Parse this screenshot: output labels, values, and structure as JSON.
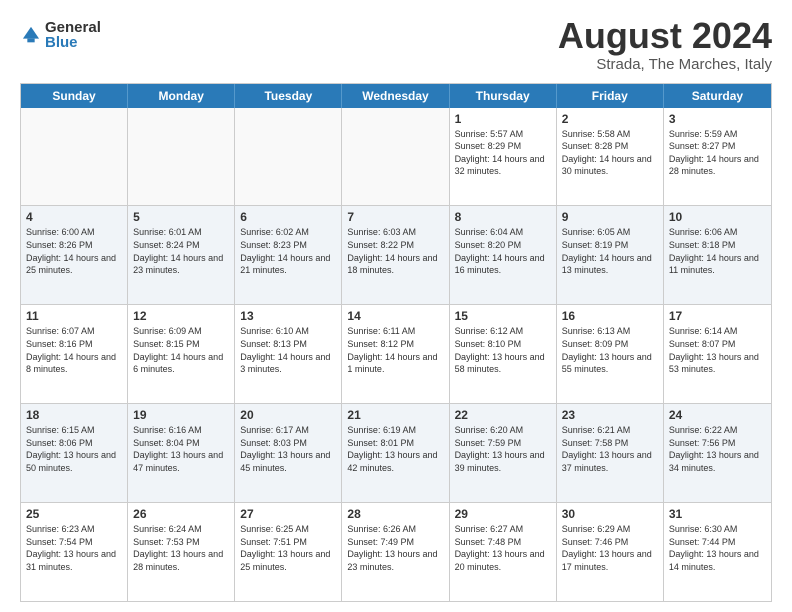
{
  "logo": {
    "general": "General",
    "blue": "Blue"
  },
  "title": "August 2024",
  "subtitle": "Strada, The Marches, Italy",
  "header_days": [
    "Sunday",
    "Monday",
    "Tuesday",
    "Wednesday",
    "Thursday",
    "Friday",
    "Saturday"
  ],
  "rows": [
    [
      {
        "day": "",
        "empty": true
      },
      {
        "day": "",
        "empty": true
      },
      {
        "day": "",
        "empty": true
      },
      {
        "day": "",
        "empty": true
      },
      {
        "day": "1",
        "sunrise": "Sunrise: 5:57 AM",
        "sunset": "Sunset: 8:29 PM",
        "daylight": "Daylight: 14 hours and 32 minutes."
      },
      {
        "day": "2",
        "sunrise": "Sunrise: 5:58 AM",
        "sunset": "Sunset: 8:28 PM",
        "daylight": "Daylight: 14 hours and 30 minutes."
      },
      {
        "day": "3",
        "sunrise": "Sunrise: 5:59 AM",
        "sunset": "Sunset: 8:27 PM",
        "daylight": "Daylight: 14 hours and 28 minutes."
      }
    ],
    [
      {
        "day": "4",
        "sunrise": "Sunrise: 6:00 AM",
        "sunset": "Sunset: 8:26 PM",
        "daylight": "Daylight: 14 hours and 25 minutes."
      },
      {
        "day": "5",
        "sunrise": "Sunrise: 6:01 AM",
        "sunset": "Sunset: 8:24 PM",
        "daylight": "Daylight: 14 hours and 23 minutes."
      },
      {
        "day": "6",
        "sunrise": "Sunrise: 6:02 AM",
        "sunset": "Sunset: 8:23 PM",
        "daylight": "Daylight: 14 hours and 21 minutes."
      },
      {
        "day": "7",
        "sunrise": "Sunrise: 6:03 AM",
        "sunset": "Sunset: 8:22 PM",
        "daylight": "Daylight: 14 hours and 18 minutes."
      },
      {
        "day": "8",
        "sunrise": "Sunrise: 6:04 AM",
        "sunset": "Sunset: 8:20 PM",
        "daylight": "Daylight: 14 hours and 16 minutes."
      },
      {
        "day": "9",
        "sunrise": "Sunrise: 6:05 AM",
        "sunset": "Sunset: 8:19 PM",
        "daylight": "Daylight: 14 hours and 13 minutes."
      },
      {
        "day": "10",
        "sunrise": "Sunrise: 6:06 AM",
        "sunset": "Sunset: 8:18 PM",
        "daylight": "Daylight: 14 hours and 11 minutes."
      }
    ],
    [
      {
        "day": "11",
        "sunrise": "Sunrise: 6:07 AM",
        "sunset": "Sunset: 8:16 PM",
        "daylight": "Daylight: 14 hours and 8 minutes."
      },
      {
        "day": "12",
        "sunrise": "Sunrise: 6:09 AM",
        "sunset": "Sunset: 8:15 PM",
        "daylight": "Daylight: 14 hours and 6 minutes."
      },
      {
        "day": "13",
        "sunrise": "Sunrise: 6:10 AM",
        "sunset": "Sunset: 8:13 PM",
        "daylight": "Daylight: 14 hours and 3 minutes."
      },
      {
        "day": "14",
        "sunrise": "Sunrise: 6:11 AM",
        "sunset": "Sunset: 8:12 PM",
        "daylight": "Daylight: 14 hours and 1 minute."
      },
      {
        "day": "15",
        "sunrise": "Sunrise: 6:12 AM",
        "sunset": "Sunset: 8:10 PM",
        "daylight": "Daylight: 13 hours and 58 minutes."
      },
      {
        "day": "16",
        "sunrise": "Sunrise: 6:13 AM",
        "sunset": "Sunset: 8:09 PM",
        "daylight": "Daylight: 13 hours and 55 minutes."
      },
      {
        "day": "17",
        "sunrise": "Sunrise: 6:14 AM",
        "sunset": "Sunset: 8:07 PM",
        "daylight": "Daylight: 13 hours and 53 minutes."
      }
    ],
    [
      {
        "day": "18",
        "sunrise": "Sunrise: 6:15 AM",
        "sunset": "Sunset: 8:06 PM",
        "daylight": "Daylight: 13 hours and 50 minutes."
      },
      {
        "day": "19",
        "sunrise": "Sunrise: 6:16 AM",
        "sunset": "Sunset: 8:04 PM",
        "daylight": "Daylight: 13 hours and 47 minutes."
      },
      {
        "day": "20",
        "sunrise": "Sunrise: 6:17 AM",
        "sunset": "Sunset: 8:03 PM",
        "daylight": "Daylight: 13 hours and 45 minutes."
      },
      {
        "day": "21",
        "sunrise": "Sunrise: 6:19 AM",
        "sunset": "Sunset: 8:01 PM",
        "daylight": "Daylight: 13 hours and 42 minutes."
      },
      {
        "day": "22",
        "sunrise": "Sunrise: 6:20 AM",
        "sunset": "Sunset: 7:59 PM",
        "daylight": "Daylight: 13 hours and 39 minutes."
      },
      {
        "day": "23",
        "sunrise": "Sunrise: 6:21 AM",
        "sunset": "Sunset: 7:58 PM",
        "daylight": "Daylight: 13 hours and 37 minutes."
      },
      {
        "day": "24",
        "sunrise": "Sunrise: 6:22 AM",
        "sunset": "Sunset: 7:56 PM",
        "daylight": "Daylight: 13 hours and 34 minutes."
      }
    ],
    [
      {
        "day": "25",
        "sunrise": "Sunrise: 6:23 AM",
        "sunset": "Sunset: 7:54 PM",
        "daylight": "Daylight: 13 hours and 31 minutes."
      },
      {
        "day": "26",
        "sunrise": "Sunrise: 6:24 AM",
        "sunset": "Sunset: 7:53 PM",
        "daylight": "Daylight: 13 hours and 28 minutes."
      },
      {
        "day": "27",
        "sunrise": "Sunrise: 6:25 AM",
        "sunset": "Sunset: 7:51 PM",
        "daylight": "Daylight: 13 hours and 25 minutes."
      },
      {
        "day": "28",
        "sunrise": "Sunrise: 6:26 AM",
        "sunset": "Sunset: 7:49 PM",
        "daylight": "Daylight: 13 hours and 23 minutes."
      },
      {
        "day": "29",
        "sunrise": "Sunrise: 6:27 AM",
        "sunset": "Sunset: 7:48 PM",
        "daylight": "Daylight: 13 hours and 20 minutes."
      },
      {
        "day": "30",
        "sunrise": "Sunrise: 6:29 AM",
        "sunset": "Sunset: 7:46 PM",
        "daylight": "Daylight: 13 hours and 17 minutes."
      },
      {
        "day": "31",
        "sunrise": "Sunrise: 6:30 AM",
        "sunset": "Sunset: 7:44 PM",
        "daylight": "Daylight: 13 hours and 14 minutes."
      }
    ]
  ]
}
